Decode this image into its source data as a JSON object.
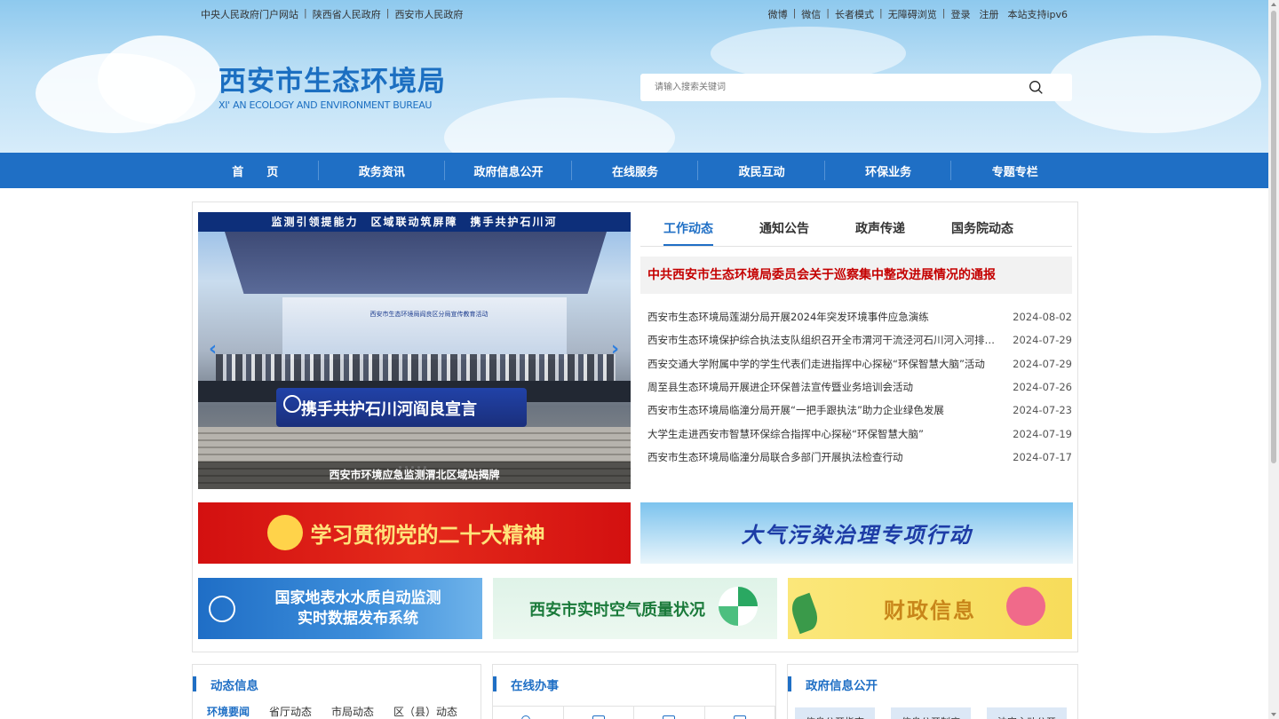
{
  "topbar": {
    "left_links": [
      "中央人民政府门户网站",
      "陕西省人民政府",
      "西安市人民政府"
    ],
    "right_links": [
      "微博",
      "微信",
      "长者模式",
      "无障碍浏览",
      "登录",
      "注册",
      "本站支持ipv6"
    ]
  },
  "logo": {
    "cn": "西安市生态环境局",
    "en": "XI' AN ECOLOGY AND ENVIRONMENT BUREAU"
  },
  "search": {
    "placeholder": "请输入搜索关键词",
    "icon": "search-icon"
  },
  "nav": {
    "items": [
      "首　　页",
      "政务资讯",
      "政府信息公开",
      "在线服务",
      "政民互动",
      "环保业务",
      "专题专栏"
    ]
  },
  "slider": {
    "banner_top": "监测引领提能力　区域联动筑屏障　携手共护石川河",
    "screen_text": "西安市生态环境局阎良区分局宣传教育活动",
    "pledge": "携手共护石川河阎良宣言",
    "caption": "西安市环境应急监测渭北区域站揭牌",
    "dot_count": 5
  },
  "news": {
    "tabs": [
      "工作动态",
      "通知公告",
      "政声传递",
      "国务院动态"
    ],
    "active_tab": 0,
    "headline": "中共西安市生态环境局委员会关于巡察集中整改进展情况的通报",
    "items": [
      {
        "title": "西安市生态环境局莲湖分局开展2024年突发环境事件应急演练",
        "date": "2024-08-02"
      },
      {
        "title": "西安市生态环境保护综合执法支队组织召开全市渭河干流泾河石川河入河排污口整治工作推进会",
        "date": "2024-07-29"
      },
      {
        "title": "西安交通大学附属中学的学生代表们走进指挥中心探秘“环保智慧大脑”活动",
        "date": "2024-07-29"
      },
      {
        "title": "周至县生态环境局开展进企环保普法宣传暨业务培训会活动",
        "date": "2024-07-26"
      },
      {
        "title": "西安市生态环境局临潼分局开展“一把手跟执法”助力企业绿色发展",
        "date": "2024-07-23"
      },
      {
        "title": "大学生走进西安市智慧环保综合指挥中心探秘“环保智慧大脑”",
        "date": "2024-07-19"
      },
      {
        "title": "西安市生态环境局临潼分局联合多部门开展执法检查行动",
        "date": "2024-07-17"
      }
    ]
  },
  "banners": {
    "party": "学习贯彻党的二十大精神",
    "air_action": "大气污染治理专项行动",
    "water_line1": "国家地表水水质自动监测",
    "water_line2": "实时数据发布系统",
    "air_quality": "西安市实时空气质量状况",
    "finance": "财政信息"
  },
  "cards": {
    "dynamic": {
      "title": "动态信息",
      "tabs": [
        "环境要闻",
        "省厅动态",
        "市局动态",
        "区（县）动态"
      ]
    },
    "online": {
      "title": "在线办事"
    },
    "gov_info": {
      "title": "政府信息公开",
      "pills": [
        "信息公开指南",
        "信息公开制度",
        "法定主动公开"
      ]
    }
  },
  "colors": {
    "nav_blue": "#1f6fc5",
    "headline_red": "#c40000"
  }
}
